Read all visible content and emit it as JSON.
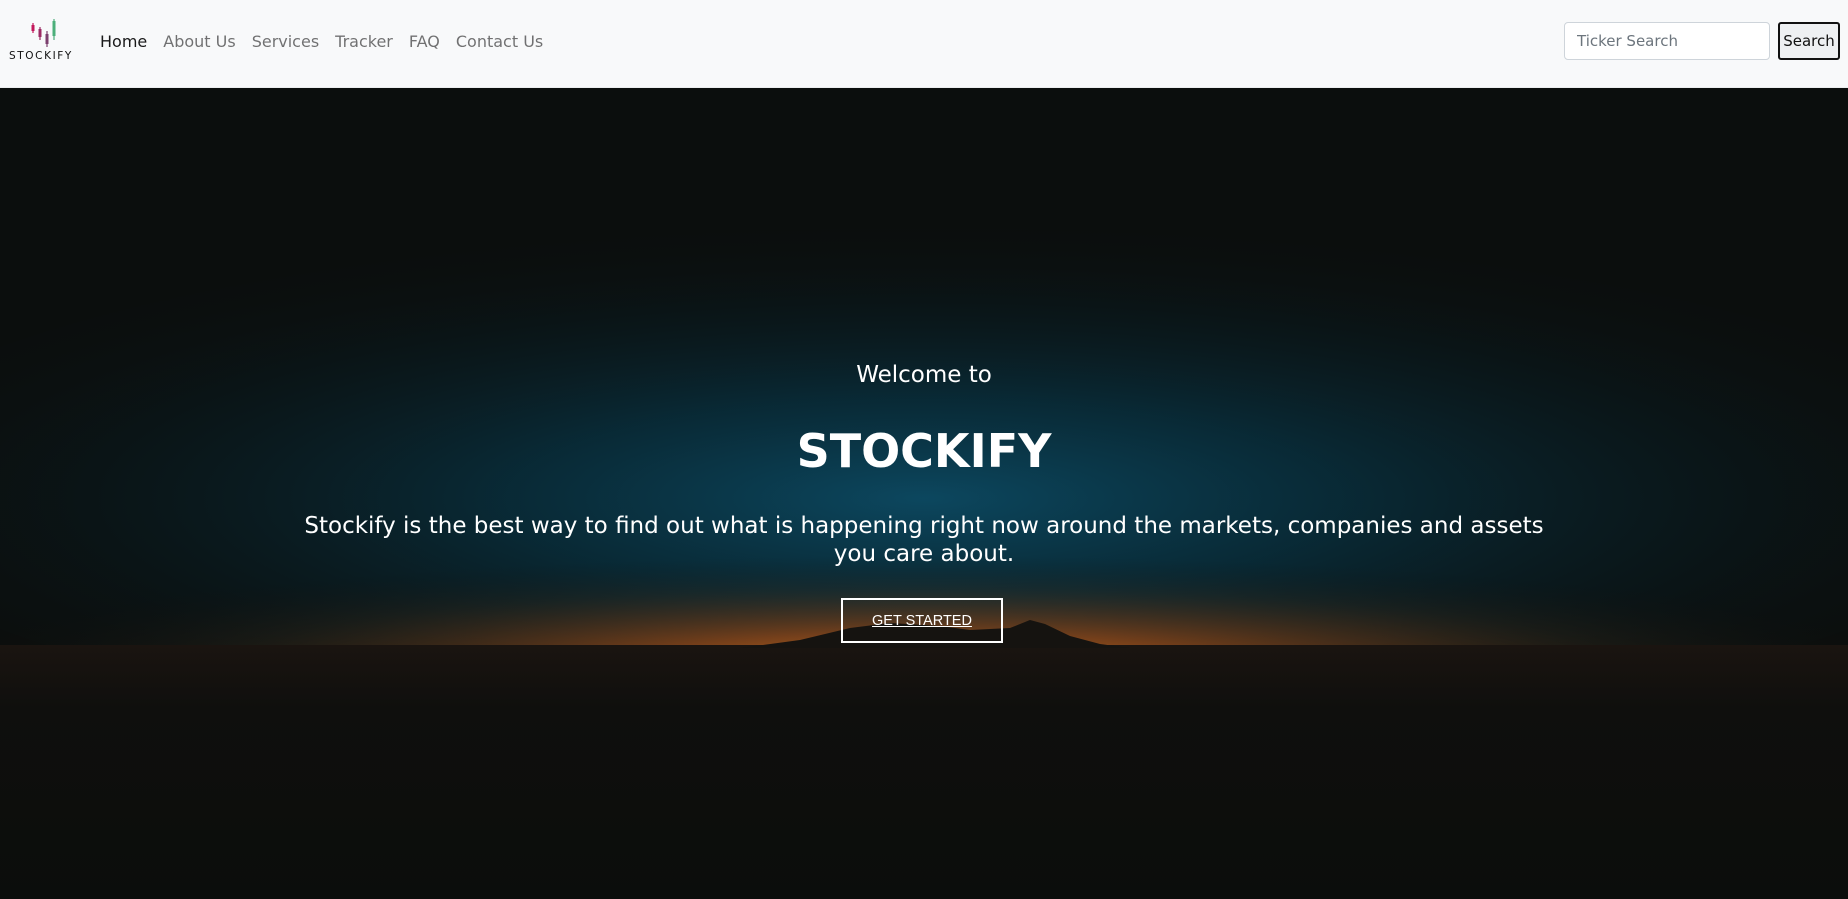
{
  "brand": {
    "name": "STOCKIFY",
    "logo_icon": "candlestick-chart-logo",
    "logo_colors": [
      "#c2185b",
      "#7b3f6e",
      "#4caf7a"
    ]
  },
  "nav": {
    "items": [
      {
        "label": "Home",
        "active": true
      },
      {
        "label": "About Us",
        "active": false
      },
      {
        "label": "Services",
        "active": false
      },
      {
        "label": "Tracker",
        "active": false
      },
      {
        "label": "FAQ",
        "active": false
      },
      {
        "label": "Contact Us",
        "active": false
      }
    ]
  },
  "search": {
    "placeholder": "Ticker Search",
    "value": "",
    "button_label": "Search"
  },
  "hero": {
    "welcome": "Welcome to",
    "title": "STOCKIFY",
    "tagline": "Stockify is the best way to find out what is happening right now around the markets, companies and assets you care about.",
    "cta_label": "GET STARTED",
    "background": "sunset-horizon-mountain-silhouette"
  },
  "colors": {
    "navbar_bg": "#f8f9fa",
    "hero_bg": "#0b0e0d",
    "horizon_glow": "#d2691e",
    "sky_blue": "#0a3a4f"
  }
}
